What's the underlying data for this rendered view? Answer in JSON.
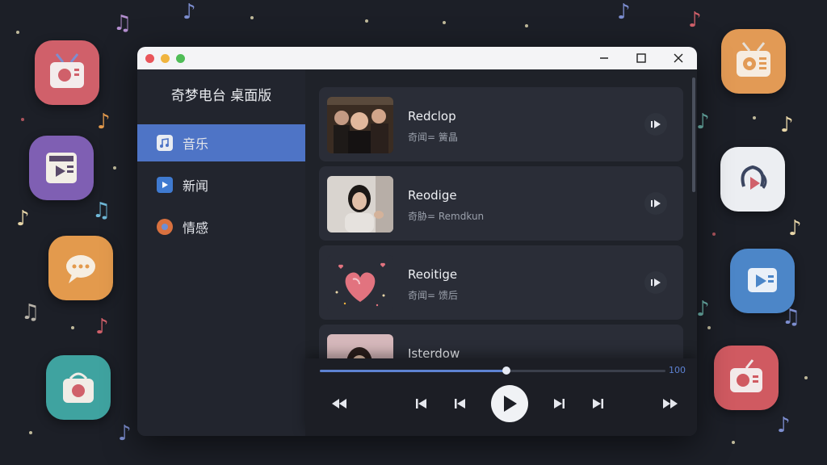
{
  "window": {
    "app_title": "奇梦电台 桌面版"
  },
  "sidebar": {
    "items": [
      {
        "label": "音乐",
        "icon": "music-folder-icon",
        "active": true
      },
      {
        "label": "新闻",
        "icon": "news-video-icon",
        "active": false
      },
      {
        "label": "情感",
        "icon": "emotion-icon",
        "active": false
      }
    ]
  },
  "tracks": [
    {
      "title": "Redclop",
      "subtitle": "奇闻= 簧晶",
      "thumbnail": "group-photo"
    },
    {
      "title": "Reodige",
      "subtitle": "奇胁= Remdkun",
      "thumbnail": "girl-portrait"
    },
    {
      "title": "Reoitige",
      "subtitle": "奇闻= 馈后",
      "thumbnail": "heart-illustration"
    },
    {
      "title": "Isterdow",
      "subtitle": "",
      "thumbnail": "woman-portrait"
    }
  ],
  "player": {
    "progress": 0.54,
    "volume_label": "100"
  },
  "colors": {
    "accent": "#4e74c6",
    "background": "#1c1f27",
    "window": "#22252e",
    "card": "#2a2d37"
  }
}
